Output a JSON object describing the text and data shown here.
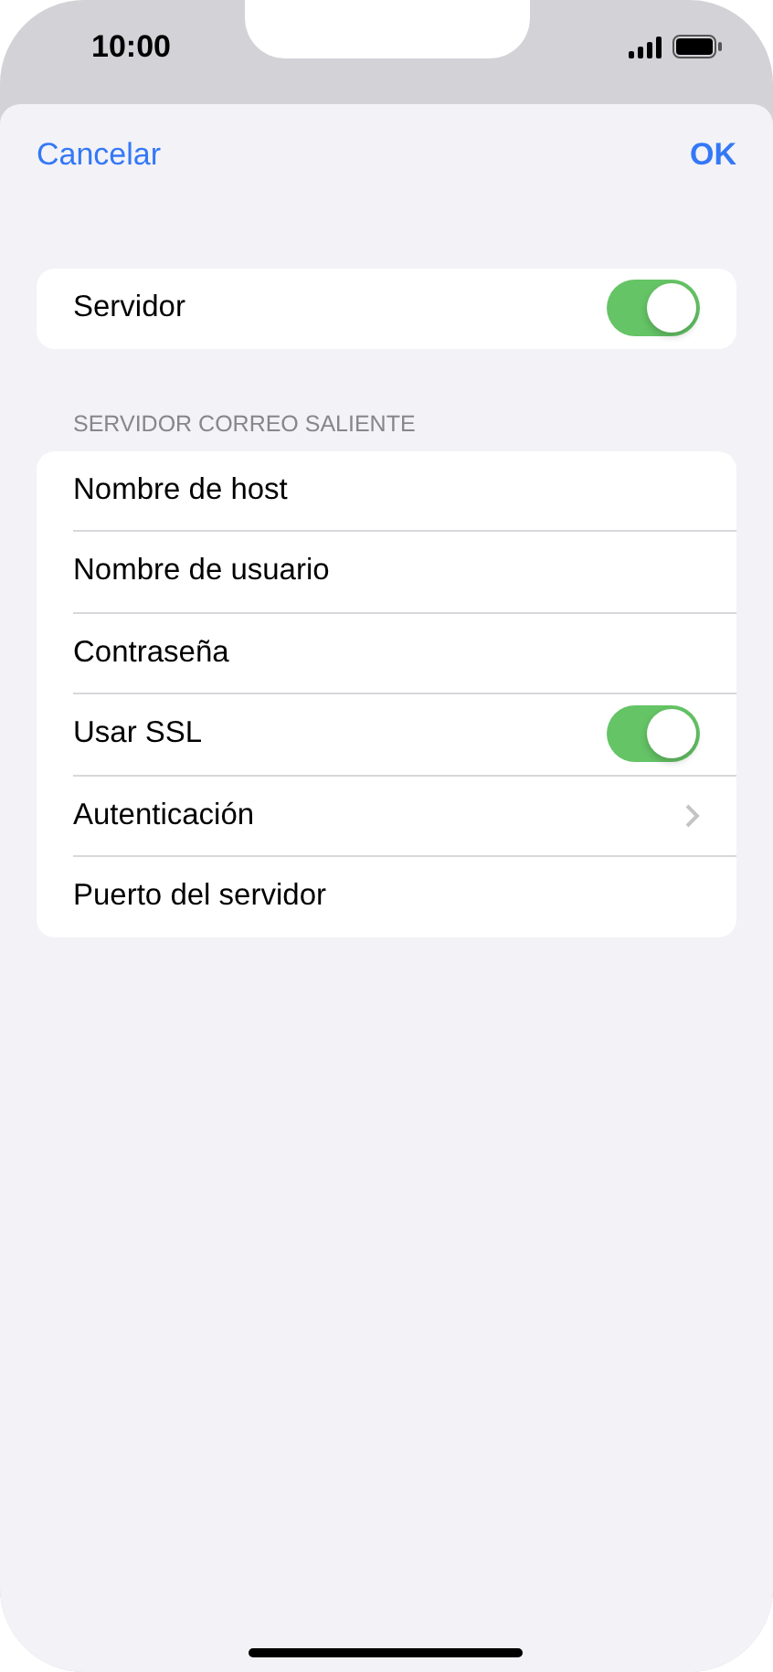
{
  "status_bar": {
    "time": "10:00"
  },
  "nav": {
    "cancel": "Cancelar",
    "confirm": "OK"
  },
  "server_group": [
    {
      "kind": "toggle",
      "label": "Servidor",
      "on": true
    }
  ],
  "outgoing_section": {
    "header": "SERVIDOR CORREO SALIENTE",
    "rows": [
      {
        "kind": "field",
        "label": "Nombre de host"
      },
      {
        "kind": "field",
        "label": "Nombre de usuario"
      },
      {
        "kind": "field",
        "label": "Contraseña"
      },
      {
        "kind": "toggle",
        "label": "Usar SSL",
        "on": true
      },
      {
        "kind": "disclosure",
        "label": "Autenticación"
      },
      {
        "kind": "field",
        "label": "Puerto del servidor"
      }
    ]
  }
}
